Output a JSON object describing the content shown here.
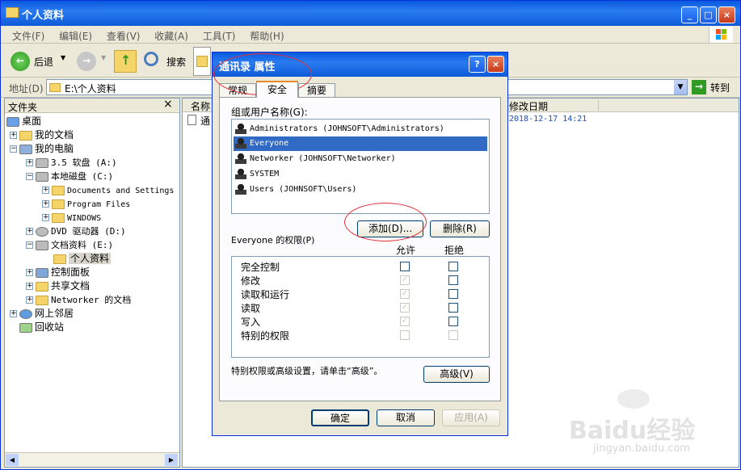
{
  "window": {
    "title": "个人资料",
    "colors": {
      "titlebar": "#0a5ae0",
      "face": "#ece9d8"
    }
  },
  "menubar": [
    "文件(F)",
    "编辑(E)",
    "查看(V)",
    "收藏(A)",
    "工具(T)",
    "帮助(H)"
  ],
  "toolbar": {
    "back": "后退",
    "search": "搜索"
  },
  "addressbar": {
    "label": "地址(D)",
    "path": "E:\\个人资料",
    "go": "转到"
  },
  "tree": {
    "header": "文件夹",
    "close": "×",
    "items": [
      {
        "label": "桌面",
        "icon": "desktop-icon"
      },
      {
        "label": "我的文档",
        "icon": "documents-icon"
      },
      {
        "label": "我的电脑",
        "icon": "computer-icon"
      },
      {
        "label": "3.5 软盘 (A:)",
        "icon": "floppy-icon"
      },
      {
        "label": "本地磁盘 (C:)",
        "icon": "drive-icon"
      },
      {
        "label": "Documents and Settings",
        "icon": "folder-icon"
      },
      {
        "label": "Program Files",
        "icon": "folder-icon"
      },
      {
        "label": "WINDOWS",
        "icon": "folder-icon"
      },
      {
        "label": "DVD 驱动器 (D:)",
        "icon": "dvd-icon"
      },
      {
        "label": "文档资料 (E:)",
        "icon": "drive-icon"
      },
      {
        "label": "个人资料",
        "icon": "folder-open-icon"
      },
      {
        "label": "控制面板",
        "icon": "control-panel-icon"
      },
      {
        "label": "共享文档",
        "icon": "folder-icon"
      },
      {
        "label": "Networker 的文档",
        "icon": "folder-icon"
      },
      {
        "label": "网上邻居",
        "icon": "network-icon"
      },
      {
        "label": "回收站",
        "icon": "recycle-bin-icon"
      }
    ]
  },
  "filelist": {
    "col_name": "名称",
    "col_date": "修改日期",
    "row_name": "通",
    "row_date": "2018-12-17 14:21"
  },
  "dialog": {
    "title": "通讯录 属性",
    "help": "?",
    "close": "×",
    "tabs": [
      "常规",
      "安全",
      "摘要"
    ],
    "group_label": "组或用户名称(G):",
    "users": [
      "Administrators (JOHNSOFT\\Administrators)",
      "Everyone",
      "Networker (JOHNSOFT\\Networker)",
      "SYSTEM",
      "Users (JOHNSOFT\\Users)"
    ],
    "add_button": "添加(D)...",
    "remove_button": "删除(R)",
    "perm_label": "Everyone 的权限(P)",
    "allow": "允许",
    "deny": "拒绝",
    "permissions": [
      "完全控制",
      "修改",
      "读取和运行",
      "读取",
      "写入",
      "特别的权限"
    ],
    "allow_state": [
      "unchecked",
      "checked-disabled",
      "checked-disabled",
      "checked-disabled",
      "checked-disabled",
      "disabled"
    ],
    "deny_state": [
      "unchecked",
      "unchecked",
      "unchecked",
      "unchecked",
      "unchecked",
      "disabled"
    ],
    "advanced_text": "特别权限或高级设置，请单击“高级”。",
    "advanced_button": "高级(V)",
    "ok": "确定",
    "cancel": "取消",
    "apply": "应用(A)"
  },
  "watermark": {
    "brand": "Baidu经验",
    "url": "jingyan.baidu.com"
  }
}
